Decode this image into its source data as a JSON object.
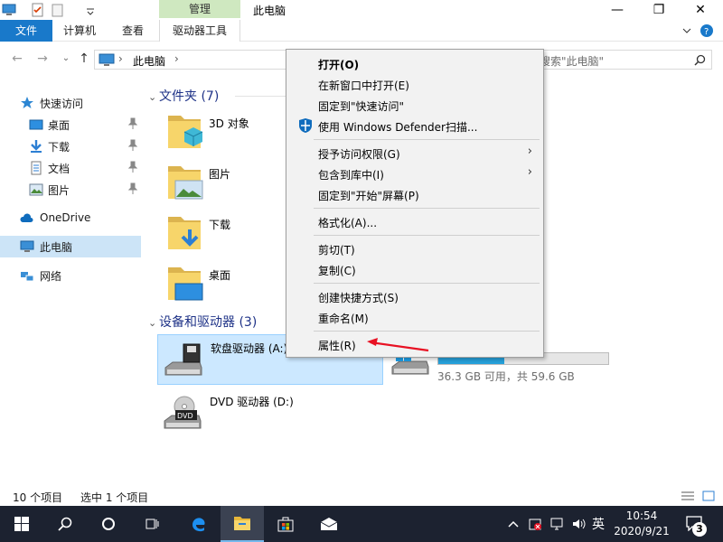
{
  "window": {
    "title": "此电脑",
    "manage_tab": "管理",
    "controls": {
      "minimize": "—",
      "maximize": "❐",
      "close": "✕"
    }
  },
  "ribbon": {
    "tabs": [
      "文件",
      "计算机",
      "查看",
      "驱动器工具"
    ]
  },
  "address": {
    "path": "此电脑",
    "search_placeholder": "搜索\"此电脑\""
  },
  "nav": {
    "quick_access": "快速访问",
    "items": [
      "桌面",
      "下载",
      "文档",
      "图片"
    ],
    "onedrive": "OneDrive",
    "this_pc": "此电脑",
    "network": "网络"
  },
  "content": {
    "folders_header": "文件夹 (7)",
    "folders": [
      "3D 对象",
      "图片",
      "下载",
      "桌面"
    ],
    "devices_header": "设备和驱动器 (3)",
    "drive_a": "软盘驱动器 (A:)",
    "drive_d": "DVD 驱动器 (D:)",
    "drive_c_free": "36.3 GB 可用，共 59.6 GB",
    "drive_c_used_fraction": 0.39
  },
  "status": {
    "items": "10 个项目",
    "selected": "选中 1 个项目"
  },
  "context_menu": {
    "open": "打开(O)",
    "open_new_window": "在新窗口中打开(E)",
    "pin_quick_access": "固定到\"快速访问\"",
    "defender_scan": "使用 Windows Defender扫描...",
    "give_access": "授予访问权限(G)",
    "include_library": "包含到库中(I)",
    "pin_start": "固定到\"开始\"屏幕(P)",
    "format": "格式化(A)...",
    "cut": "剪切(T)",
    "copy": "复制(C)",
    "create_shortcut": "创建快捷方式(S)",
    "rename": "重命名(M)",
    "properties": "属性(R)",
    "submenu_arrow": "›"
  },
  "taskbar": {
    "lang": "英",
    "time": "10:54",
    "date": "2020/9/21",
    "notifications": "3"
  },
  "colors": {
    "accent": "#1979ca",
    "selection": "#cce8ff",
    "annotation": "#e81123"
  }
}
